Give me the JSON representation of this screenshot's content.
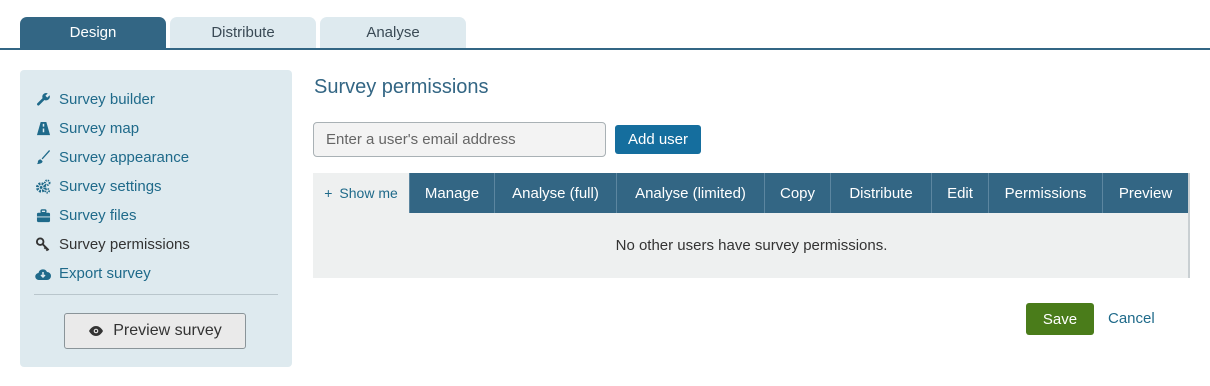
{
  "tabs": [
    "Design",
    "Distribute",
    "Analyse"
  ],
  "sidebar": {
    "items": [
      {
        "label": "Survey builder",
        "icon": "wrench-icon"
      },
      {
        "label": "Survey map",
        "icon": "road-icon"
      },
      {
        "label": "Survey appearance",
        "icon": "brush-icon"
      },
      {
        "label": "Survey settings",
        "icon": "cogs-icon"
      },
      {
        "label": "Survey files",
        "icon": "briefcase-icon"
      },
      {
        "label": "Survey permissions",
        "icon": "key-icon"
      },
      {
        "label": "Export survey",
        "icon": "cloud-download-icon"
      }
    ],
    "preview_label": "Preview survey"
  },
  "main": {
    "title": "Survey permissions",
    "email_placeholder": "Enter a user's email address",
    "add_user_label": "Add user",
    "table": {
      "show_me_label": "Show me",
      "columns": [
        "Manage",
        "Analyse (full)",
        "Analyse (limited)",
        "Copy",
        "Distribute",
        "Edit",
        "Permissions",
        "Preview"
      ],
      "empty_message": "No other users have survey permissions."
    },
    "save_label": "Save",
    "cancel_label": "Cancel"
  },
  "colors": {
    "primary": "#336684",
    "link": "#1f6a8a",
    "save": "#4a7c1a",
    "add_user": "#156e9e",
    "sidebar_bg": "#deeaef"
  }
}
